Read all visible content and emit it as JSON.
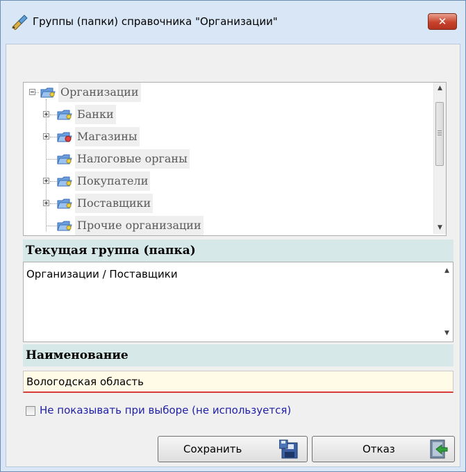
{
  "window": {
    "title": "Группы (папки) справочника \"Организации\"",
    "close_label": "✕"
  },
  "tree": {
    "root": "Организации",
    "items": [
      {
        "label": "Банки",
        "icon": "folder-icon",
        "expandable": true
      },
      {
        "label": "Магазины",
        "icon": "folder-red-icon",
        "expandable": true
      },
      {
        "label": "Налоговые органы",
        "icon": "folder-icon",
        "expandable": false
      },
      {
        "label": "Покупатели",
        "icon": "folder-icon",
        "expandable": true
      },
      {
        "label": "Поставщики",
        "icon": "folder-icon",
        "expandable": true
      },
      {
        "label": "Прочие организации",
        "icon": "folder-icon",
        "expandable": false
      }
    ]
  },
  "current_group": {
    "title": "Текущая группа (папка)",
    "value": "Организации / Поставщики"
  },
  "name": {
    "title": "Наименование",
    "value": "Вологодская область"
  },
  "hide_option": {
    "label": "Не показывать при  выборе (не используется)",
    "checked": false
  },
  "buttons": {
    "save": "Сохранить",
    "cancel": "Отказ"
  },
  "colors": {
    "section_header": "#d7e8e8",
    "input_background": "#fffbe6",
    "input_underline": "#d93a3a",
    "checkbox_label": "#1f1fa8"
  }
}
